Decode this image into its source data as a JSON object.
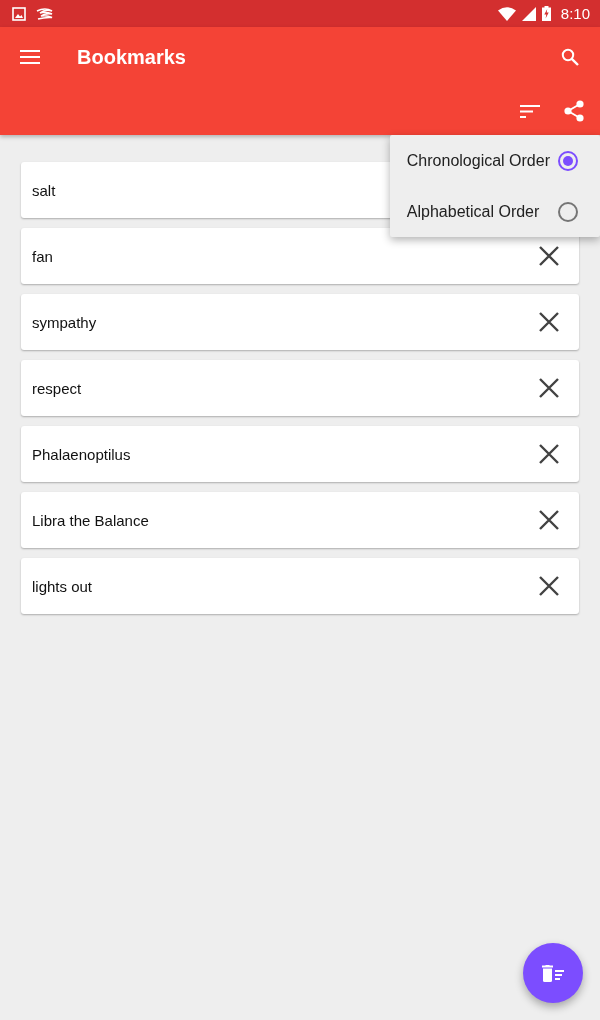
{
  "status_bar": {
    "time": "8:10"
  },
  "app_bar": {
    "title": "Bookmarks"
  },
  "bookmarks": [
    {
      "text": "salt"
    },
    {
      "text": "fan"
    },
    {
      "text": "sympathy"
    },
    {
      "text": "respect"
    },
    {
      "text": "Phalaenoptilus"
    },
    {
      "text": "Libra the Balance"
    },
    {
      "text": "lights out"
    }
  ],
  "sort_menu": {
    "options": [
      {
        "label": "Chronological Order",
        "selected": true
      },
      {
        "label": "Alphabetical Order",
        "selected": false
      }
    ]
  }
}
